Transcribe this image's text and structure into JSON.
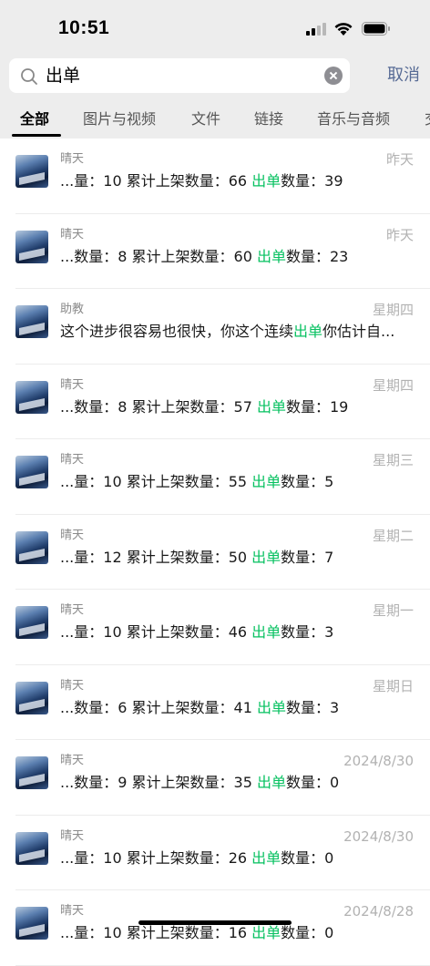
{
  "status_bar": {
    "time": "10:51"
  },
  "search": {
    "query": "出单",
    "cancel_label": "取消"
  },
  "tabs": [
    {
      "label": "全部",
      "active": true
    },
    {
      "label": "图片与视频"
    },
    {
      "label": "文件"
    },
    {
      "label": "链接"
    },
    {
      "label": "音乐与音频"
    },
    {
      "label": "交"
    }
  ],
  "results": [
    {
      "name": "晴天",
      "date": "昨天",
      "before": "...量：10 累计上架数量：66 ",
      "highlight": "出单",
      "after": "数量：39"
    },
    {
      "name": "晴天",
      "date": "昨天",
      "before": "...数量：8 累计上架数量：60 ",
      "highlight": "出单",
      "after": "数量：23"
    },
    {
      "name": "助教",
      "date": "星期四",
      "before": "这个进步很容易也很快，你这个连续",
      "highlight": "出单",
      "after": "你估计自..."
    },
    {
      "name": "晴天",
      "date": "星期四",
      "before": "...数量：8 累计上架数量：57 ",
      "highlight": "出单",
      "after": "数量：19"
    },
    {
      "name": "晴天",
      "date": "星期三",
      "before": "...量：10 累计上架数量：55 ",
      "highlight": "出单",
      "after": "数量：5"
    },
    {
      "name": "晴天",
      "date": "星期二",
      "before": "...量：12 累计上架数量：50 ",
      "highlight": "出单",
      "after": "数量：7"
    },
    {
      "name": "晴天",
      "date": "星期一",
      "before": "...量：10 累计上架数量：46 ",
      "highlight": "出单",
      "after": "数量：3"
    },
    {
      "name": "晴天",
      "date": "星期日",
      "before": "...数量：6 累计上架数量：41 ",
      "highlight": "出单",
      "after": "数量：3"
    },
    {
      "name": "晴天",
      "date": "2024/8/30",
      "before": "...数量：9 累计上架数量：35 ",
      "highlight": "出单",
      "after": "数量：0"
    },
    {
      "name": "晴天",
      "date": "2024/8/30",
      "before": "...量：10 累计上架数量：26 ",
      "highlight": "出单",
      "after": "数量：0"
    },
    {
      "name": "晴天",
      "date": "2024/8/28",
      "before": "...量：10 累计上架数量：16 ",
      "highlight": "出单",
      "after": "数量：0"
    }
  ]
}
